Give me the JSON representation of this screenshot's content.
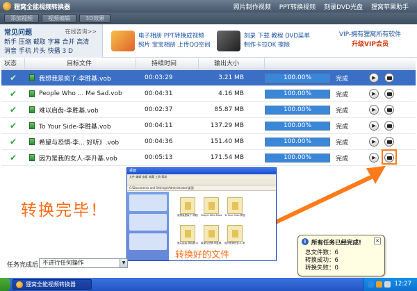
{
  "window": {
    "title": "狸窝全能视频转换器",
    "menu": [
      "照片制作视频",
      "PPT转换视频",
      "刻录DVD光盘",
      "狸窝苹果助手"
    ]
  },
  "toolbar": {
    "tabs": [
      "添加视频",
      "视频编辑",
      "3D效果"
    ]
  },
  "faq": {
    "title": "常见问题",
    "link": "在线咨询>>",
    "row1": "新手 压缩 截取 字幕 合并 高清",
    "row2": "消音 手机 片头 快播 3 D"
  },
  "promos": [
    {
      "line1": "电子相册  PPT转换成视频",
      "line2": "照片  宝宝相册  上传QQ空间"
    },
    {
      "line1": "刻录 下载  教程  DVD菜单",
      "line2": "制作卡拉OK  擦除"
    }
  ],
  "vip": {
    "line1": "VIP-拥有狸窝所有软件",
    "line2": "升级VIP会员"
  },
  "table": {
    "headers": [
      "状态",
      "目标文件",
      "持续时间",
      "输出大小"
    ],
    "rows": [
      {
        "file": "我想我是疯了-李胜基.vob",
        "duration": "00:03:29",
        "size": "3.21 MB",
        "progress": "100.00%",
        "status": "完成",
        "progress_value": 100
      },
      {
        "file": "People Who ... Me Sad.vob",
        "duration": "00:04:31",
        "size": "4.16 MB",
        "progress": "100.00%",
        "status": "完成",
        "progress_value": 100
      },
      {
        "file": "难以启齿-李胜基.vob",
        "duration": "00:02:37",
        "size": "85.87 MB",
        "progress": "100.00%",
        "status": "完成",
        "progress_value": 100
      },
      {
        "file": "To Your Side-李胜基.vob",
        "duration": "00:04:11",
        "size": "137.29 MB",
        "progress": "100.00%",
        "status": "完成",
        "progress_value": 100
      },
      {
        "file": "希望与恐惧-李... 好听》.vob",
        "duration": "00:04:36",
        "size": "151.40 MB",
        "progress": "100.00%",
        "status": "完成",
        "progress_value": 100
      },
      {
        "file": "因为是我的女人-李升基.vob",
        "duration": "00:05:13",
        "size": "171.54 MB",
        "progress": "100.00%",
        "status": "完成",
        "progress_value": 100
      }
    ]
  },
  "overlay": {
    "done_text": "转换完毕！",
    "converted_caption": "转换好的文件"
  },
  "explorer": {
    "title": "桌面",
    "menu": "文件 编辑 查看 收藏 工具 帮助",
    "address": "C:\\Documents and Settings\\Administrator\\桌面",
    "files": [
      "我想我是疯了-李胜基.vob",
      "People Who Make Me Sad.vob",
      "To Your Side-李胜基.vob",
      "难以启齿-李胜基.vob",
      "希望与恐惧-李胜基.vob",
      "因为是我的女人-李升基.vob"
    ]
  },
  "bottom": {
    "after_label": "任务完成后:",
    "after_value": "不进行任何操作"
  },
  "notification": {
    "title": "所有任务已经完成!",
    "total": "总文件数：6",
    "success": "转换成功：6",
    "failed": "转换失败：0"
  },
  "taskbar": {
    "app": "狸窝全能视频转换器",
    "clock": "12:27"
  },
  "colors": {
    "accent": "#ff6c17",
    "selected_row": "#3a6fc5",
    "progress_fill": "#3a86d9",
    "check": "#2aa640"
  }
}
